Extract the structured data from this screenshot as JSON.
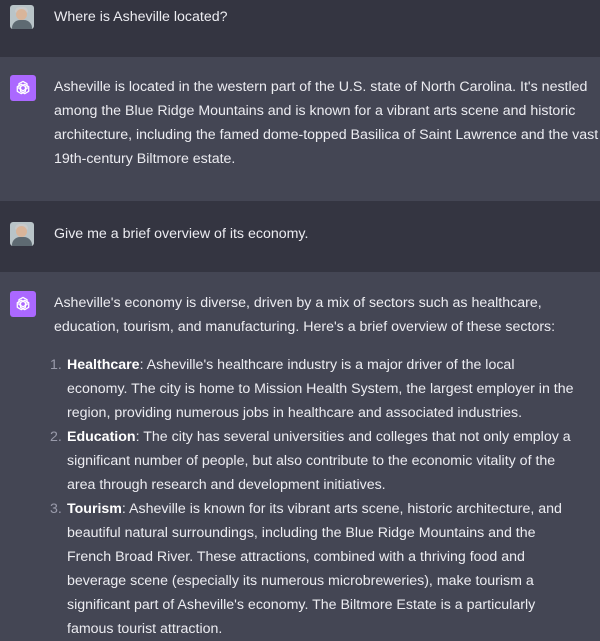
{
  "conversation": [
    {
      "role": "user",
      "avatar": "user-photo",
      "text": "Where is Asheville located?"
    },
    {
      "role": "assistant",
      "avatar": "openai-logo-icon",
      "text": "Asheville is located in the western part of the U.S. state of North Carolina. It's nestled among the Blue Ridge Mountains and is known for a vibrant arts scene and historic architecture, including the famed dome-topped Basilica of Saint Lawrence and the vast 19th-century Biltmore estate."
    },
    {
      "role": "user",
      "avatar": "user-photo",
      "text": "Give me a brief overview of its economy."
    },
    {
      "role": "assistant",
      "avatar": "openai-logo-icon",
      "intro": "Asheville's economy is diverse, driven by a mix of sectors such as healthcare, education, tourism, and manufacturing. Here's a brief overview of these sectors:",
      "list": [
        {
          "number": "1.",
          "title": "Healthcare",
          "text": ": Asheville's healthcare industry is a major driver of the local economy. The city is home to Mission Health System, the largest employer in the region, providing numerous jobs in healthcare and associated industries."
        },
        {
          "number": "2.",
          "title": "Education",
          "text": ": The city has several universities and colleges that not only employ a significant number of people, but also contribute to the economic vitality of the area through research and development initiatives."
        },
        {
          "number": "3.",
          "title": "Tourism",
          "text": ": Asheville is known for its vibrant arts scene, historic architecture, and beautiful natural surroundings, including the Blue Ridge Mountains and the French Broad River. These attractions, combined with a thriving food and beverage scene (especially its numerous microbreweries), make tourism a significant part of Asheville's economy. The Biltmore Estate is a particularly famous tourist attraction."
        }
      ]
    }
  ],
  "colors": {
    "user_bg": "#343541",
    "assistant_bg": "#444654",
    "text": "#ececf1",
    "gpt_icon_bg": "#ab68ff"
  }
}
